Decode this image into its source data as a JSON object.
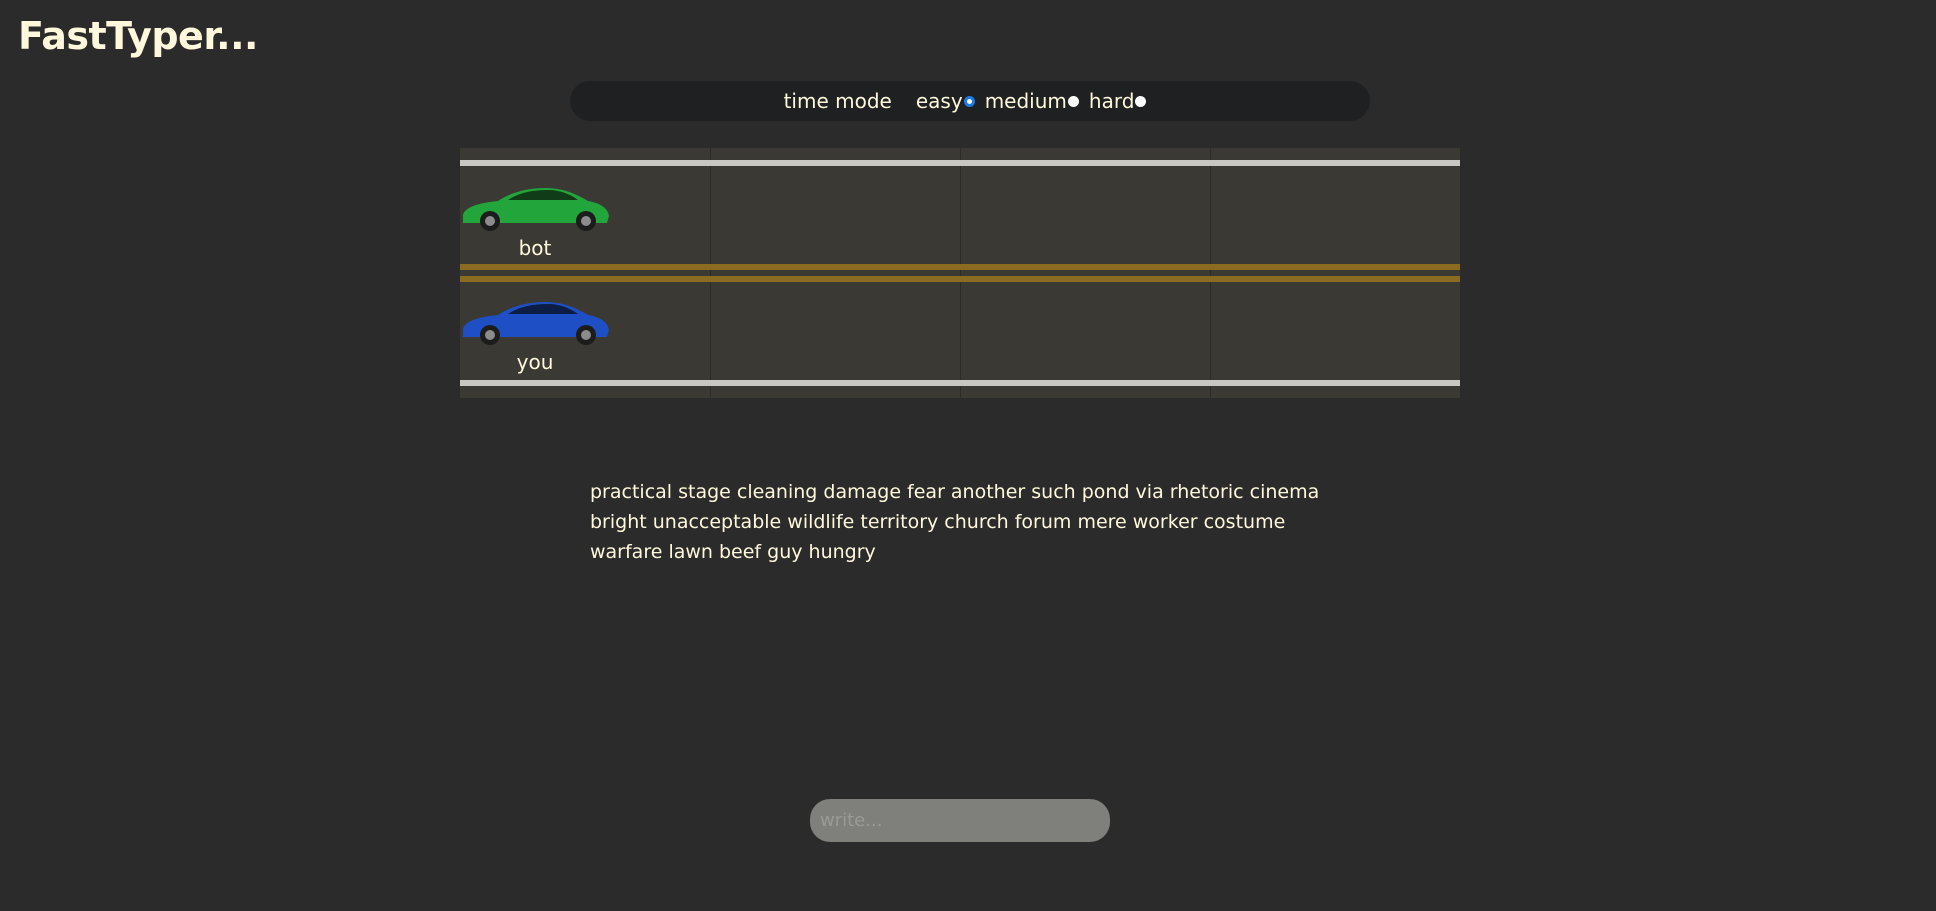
{
  "app": {
    "title": "FastTyper..."
  },
  "mode_bar": {
    "label": "time mode",
    "options": [
      {
        "label": "easy",
        "selected": true
      },
      {
        "label": "medium",
        "selected": false
      },
      {
        "label": "hard",
        "selected": false
      }
    ]
  },
  "race": {
    "bot": {
      "label": "bot",
      "color": "#22a53a"
    },
    "you": {
      "label": "you",
      "color": "#1f4fc4"
    }
  },
  "text_to_type": "practical stage cleaning damage fear another such pond via rhetoric cinema bright unacceptable wildlife territory church forum mere worker costume warfare lawn beef guy hungry",
  "input": {
    "placeholder": "write...",
    "value": ""
  }
}
